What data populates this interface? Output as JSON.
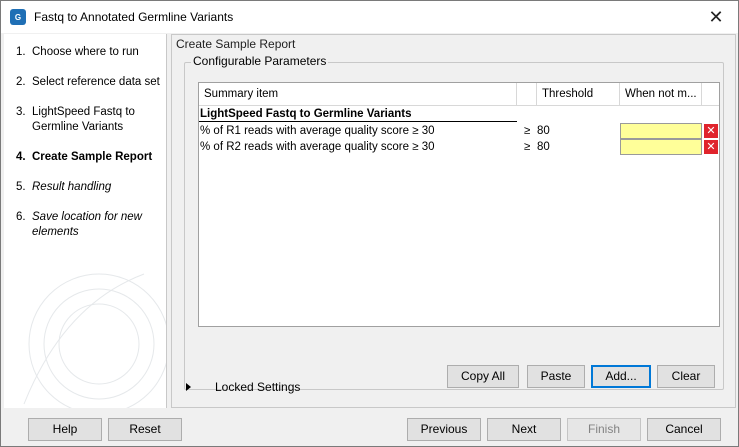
{
  "window": {
    "title": "Fastq to Annotated Germline Variants",
    "app_icon_text": "G",
    "close_glyph": "✕"
  },
  "steps": [
    {
      "num": "1.",
      "label": "Choose where to run",
      "state": "done"
    },
    {
      "num": "2.",
      "label": "Select reference data set",
      "state": "done"
    },
    {
      "num": "3.",
      "label": "LightSpeed Fastq to Germline Variants",
      "state": "done"
    },
    {
      "num": "4.",
      "label": "Create Sample Report",
      "state": "current"
    },
    {
      "num": "5.",
      "label": "Result handling",
      "state": "future"
    },
    {
      "num": "6.",
      "label": "Save location for new elements",
      "state": "future"
    }
  ],
  "main": {
    "section_title": "Create Sample Report",
    "group_title": "Configurable Parameters",
    "table": {
      "columns": [
        "Summary item",
        "",
        "Threshold",
        "When not m..."
      ],
      "group_label": "LightSpeed Fastq to Germline Variants",
      "rows": [
        {
          "item": "% of R1 reads with average quality score ≥ 30",
          "op": "≥",
          "threshold": "80",
          "when_not_met": ""
        },
        {
          "item": "% of R2 reads with average quality score ≥ 30",
          "op": "≥",
          "threshold": "80",
          "when_not_met": ""
        }
      ],
      "delete_glyph": "✕"
    },
    "buttons": {
      "copy_all": "Copy All",
      "paste": "Paste",
      "add": "Add...",
      "clear": "Clear"
    },
    "locked_settings": "Locked Settings"
  },
  "footer": {
    "help": "Help",
    "reset": "Reset",
    "previous": "Previous",
    "next": "Next",
    "finish": "Finish",
    "cancel": "Cancel"
  },
  "colors": {
    "highlight_field": "#ffff99",
    "delete_red": "#e0242c",
    "focus_blue": "#0078d7"
  }
}
